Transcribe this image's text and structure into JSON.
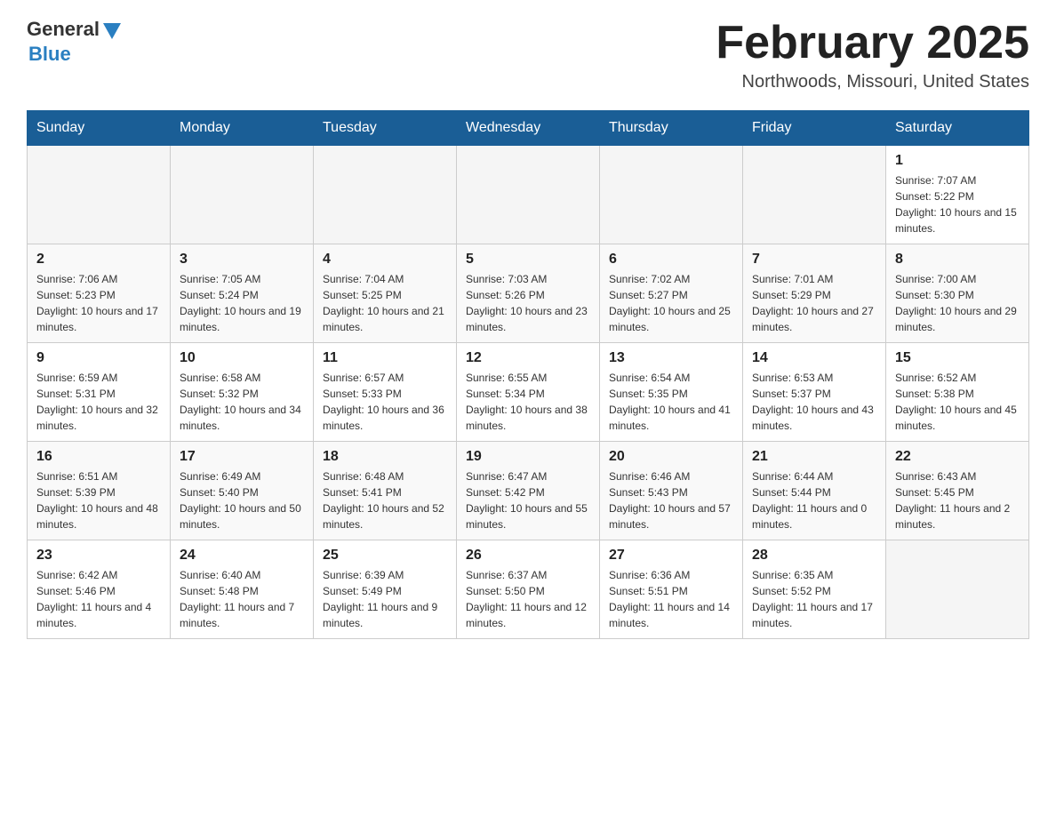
{
  "header": {
    "logo_general": "General",
    "logo_blue": "Blue",
    "month_title": "February 2025",
    "location": "Northwoods, Missouri, United States"
  },
  "days_of_week": [
    "Sunday",
    "Monday",
    "Tuesday",
    "Wednesday",
    "Thursday",
    "Friday",
    "Saturday"
  ],
  "weeks": [
    [
      {
        "day": "",
        "sunrise": "",
        "sunset": "",
        "daylight": ""
      },
      {
        "day": "",
        "sunrise": "",
        "sunset": "",
        "daylight": ""
      },
      {
        "day": "",
        "sunrise": "",
        "sunset": "",
        "daylight": ""
      },
      {
        "day": "",
        "sunrise": "",
        "sunset": "",
        "daylight": ""
      },
      {
        "day": "",
        "sunrise": "",
        "sunset": "",
        "daylight": ""
      },
      {
        "day": "",
        "sunrise": "",
        "sunset": "",
        "daylight": ""
      },
      {
        "day": "1",
        "sunrise": "Sunrise: 7:07 AM",
        "sunset": "Sunset: 5:22 PM",
        "daylight": "Daylight: 10 hours and 15 minutes."
      }
    ],
    [
      {
        "day": "2",
        "sunrise": "Sunrise: 7:06 AM",
        "sunset": "Sunset: 5:23 PM",
        "daylight": "Daylight: 10 hours and 17 minutes."
      },
      {
        "day": "3",
        "sunrise": "Sunrise: 7:05 AM",
        "sunset": "Sunset: 5:24 PM",
        "daylight": "Daylight: 10 hours and 19 minutes."
      },
      {
        "day": "4",
        "sunrise": "Sunrise: 7:04 AM",
        "sunset": "Sunset: 5:25 PM",
        "daylight": "Daylight: 10 hours and 21 minutes."
      },
      {
        "day": "5",
        "sunrise": "Sunrise: 7:03 AM",
        "sunset": "Sunset: 5:26 PM",
        "daylight": "Daylight: 10 hours and 23 minutes."
      },
      {
        "day": "6",
        "sunrise": "Sunrise: 7:02 AM",
        "sunset": "Sunset: 5:27 PM",
        "daylight": "Daylight: 10 hours and 25 minutes."
      },
      {
        "day": "7",
        "sunrise": "Sunrise: 7:01 AM",
        "sunset": "Sunset: 5:29 PM",
        "daylight": "Daylight: 10 hours and 27 minutes."
      },
      {
        "day": "8",
        "sunrise": "Sunrise: 7:00 AM",
        "sunset": "Sunset: 5:30 PM",
        "daylight": "Daylight: 10 hours and 29 minutes."
      }
    ],
    [
      {
        "day": "9",
        "sunrise": "Sunrise: 6:59 AM",
        "sunset": "Sunset: 5:31 PM",
        "daylight": "Daylight: 10 hours and 32 minutes."
      },
      {
        "day": "10",
        "sunrise": "Sunrise: 6:58 AM",
        "sunset": "Sunset: 5:32 PM",
        "daylight": "Daylight: 10 hours and 34 minutes."
      },
      {
        "day": "11",
        "sunrise": "Sunrise: 6:57 AM",
        "sunset": "Sunset: 5:33 PM",
        "daylight": "Daylight: 10 hours and 36 minutes."
      },
      {
        "day": "12",
        "sunrise": "Sunrise: 6:55 AM",
        "sunset": "Sunset: 5:34 PM",
        "daylight": "Daylight: 10 hours and 38 minutes."
      },
      {
        "day": "13",
        "sunrise": "Sunrise: 6:54 AM",
        "sunset": "Sunset: 5:35 PM",
        "daylight": "Daylight: 10 hours and 41 minutes."
      },
      {
        "day": "14",
        "sunrise": "Sunrise: 6:53 AM",
        "sunset": "Sunset: 5:37 PM",
        "daylight": "Daylight: 10 hours and 43 minutes."
      },
      {
        "day": "15",
        "sunrise": "Sunrise: 6:52 AM",
        "sunset": "Sunset: 5:38 PM",
        "daylight": "Daylight: 10 hours and 45 minutes."
      }
    ],
    [
      {
        "day": "16",
        "sunrise": "Sunrise: 6:51 AM",
        "sunset": "Sunset: 5:39 PM",
        "daylight": "Daylight: 10 hours and 48 minutes."
      },
      {
        "day": "17",
        "sunrise": "Sunrise: 6:49 AM",
        "sunset": "Sunset: 5:40 PM",
        "daylight": "Daylight: 10 hours and 50 minutes."
      },
      {
        "day": "18",
        "sunrise": "Sunrise: 6:48 AM",
        "sunset": "Sunset: 5:41 PM",
        "daylight": "Daylight: 10 hours and 52 minutes."
      },
      {
        "day": "19",
        "sunrise": "Sunrise: 6:47 AM",
        "sunset": "Sunset: 5:42 PM",
        "daylight": "Daylight: 10 hours and 55 minutes."
      },
      {
        "day": "20",
        "sunrise": "Sunrise: 6:46 AM",
        "sunset": "Sunset: 5:43 PM",
        "daylight": "Daylight: 10 hours and 57 minutes."
      },
      {
        "day": "21",
        "sunrise": "Sunrise: 6:44 AM",
        "sunset": "Sunset: 5:44 PM",
        "daylight": "Daylight: 11 hours and 0 minutes."
      },
      {
        "day": "22",
        "sunrise": "Sunrise: 6:43 AM",
        "sunset": "Sunset: 5:45 PM",
        "daylight": "Daylight: 11 hours and 2 minutes."
      }
    ],
    [
      {
        "day": "23",
        "sunrise": "Sunrise: 6:42 AM",
        "sunset": "Sunset: 5:46 PM",
        "daylight": "Daylight: 11 hours and 4 minutes."
      },
      {
        "day": "24",
        "sunrise": "Sunrise: 6:40 AM",
        "sunset": "Sunset: 5:48 PM",
        "daylight": "Daylight: 11 hours and 7 minutes."
      },
      {
        "day": "25",
        "sunrise": "Sunrise: 6:39 AM",
        "sunset": "Sunset: 5:49 PM",
        "daylight": "Daylight: 11 hours and 9 minutes."
      },
      {
        "day": "26",
        "sunrise": "Sunrise: 6:37 AM",
        "sunset": "Sunset: 5:50 PM",
        "daylight": "Daylight: 11 hours and 12 minutes."
      },
      {
        "day": "27",
        "sunrise": "Sunrise: 6:36 AM",
        "sunset": "Sunset: 5:51 PM",
        "daylight": "Daylight: 11 hours and 14 minutes."
      },
      {
        "day": "28",
        "sunrise": "Sunrise: 6:35 AM",
        "sunset": "Sunset: 5:52 PM",
        "daylight": "Daylight: 11 hours and 17 minutes."
      },
      {
        "day": "",
        "sunrise": "",
        "sunset": "",
        "daylight": ""
      }
    ]
  ]
}
